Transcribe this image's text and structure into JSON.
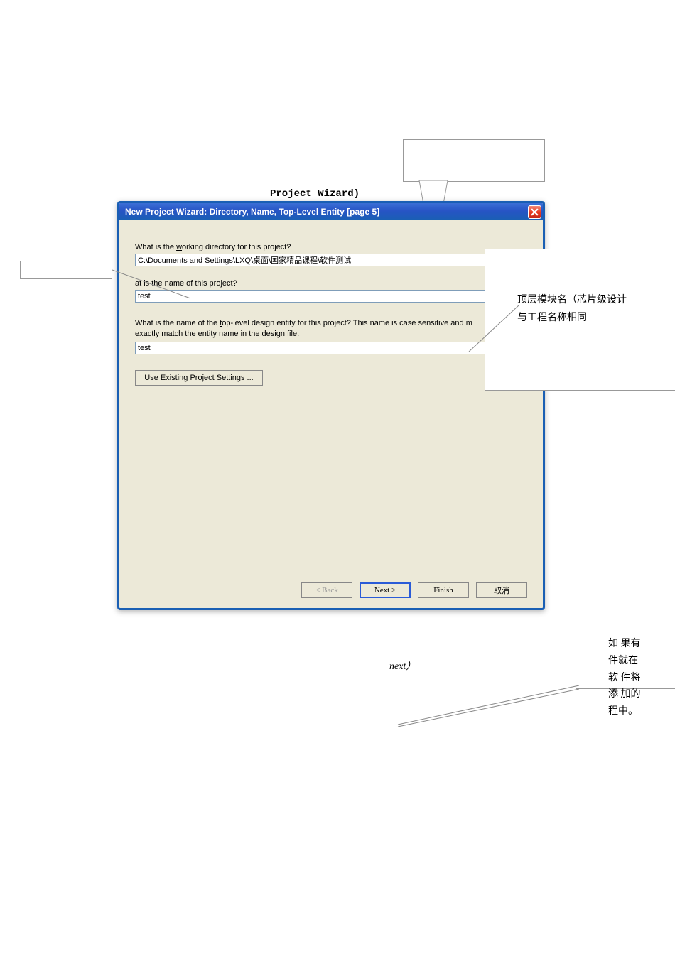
{
  "header_text": "Project Wizard)",
  "dialog": {
    "title": "New Project Wizard: Directory, Name, Top-Level Entity [page       5]",
    "label_working_dir": "What is the working directory for this project?",
    "working_dir_value": "C:\\Documents and Settings\\LXQ\\桌面\\国家精品课程\\软件测试",
    "label_project_name": "at is the name of this project?",
    "project_name_value": "test",
    "label_entity": "What is the name of the top-level design entity for this project? This name is case sensitive and m exactly match the entity name in the design file.",
    "entity_value": "test",
    "use_existing": "se Existing Project Settings ...",
    "browse": "...",
    "buttons": {
      "back": "< Back",
      "next": "Next >",
      "finish": "Finish",
      "cancel": "取消"
    }
  },
  "callout_right": {
    "line1": "顶层模块名（芯片级设计",
    "line2": "与工程名称相同"
  },
  "next_text": "next）",
  "callout_bottom": {
    "l1": "如 果有",
    "l2": "件就在",
    "l3": "软 件将",
    "l4": "添 加的",
    "l5": "程中。"
  }
}
